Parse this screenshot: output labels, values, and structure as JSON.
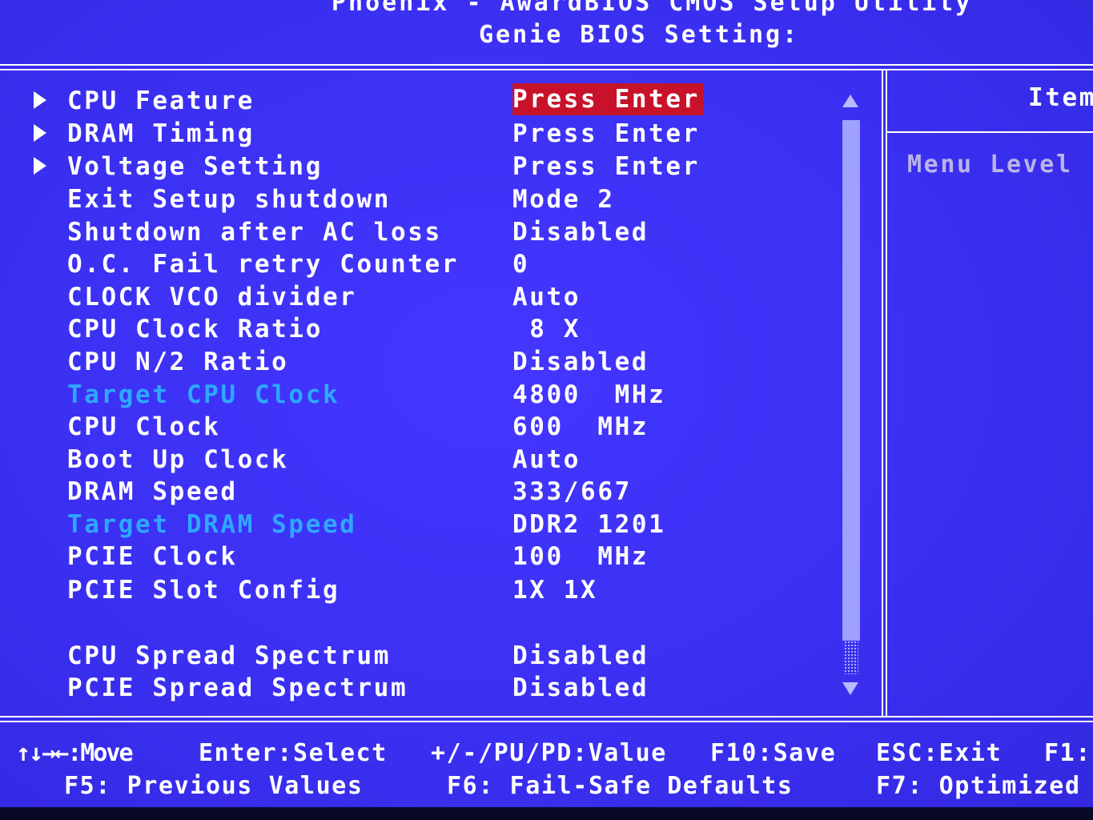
{
  "header": {
    "title": "Phoenix - AwardBIOS CMOS Setup Utility",
    "subtitle": "Genie BIOS Setting:"
  },
  "menu": {
    "items": [
      {
        "label": "CPU Feature",
        "value": "Press Enter",
        "submenu": true,
        "selected": true,
        "highlight": false
      },
      {
        "label": "DRAM Timing",
        "value": "Press Enter",
        "submenu": true,
        "selected": false,
        "highlight": false
      },
      {
        "label": "Voltage Setting",
        "value": "Press Enter",
        "submenu": true,
        "selected": false,
        "highlight": false
      },
      {
        "label": "Exit Setup shutdown",
        "value": "Mode 2",
        "submenu": false,
        "selected": false,
        "highlight": false
      },
      {
        "label": "Shutdown after AC loss",
        "value": "Disabled",
        "submenu": false,
        "selected": false,
        "highlight": false
      },
      {
        "label": "O.C. Fail retry Counter",
        "value": "0",
        "submenu": false,
        "selected": false,
        "highlight": false
      },
      {
        "label": "CLOCK VCO divider",
        "value": "Auto",
        "submenu": false,
        "selected": false,
        "highlight": false
      },
      {
        "label": "CPU Clock Ratio",
        "value": " 8 X",
        "submenu": false,
        "selected": false,
        "highlight": false
      },
      {
        "label": "CPU N/2 Ratio",
        "value": "Disabled",
        "submenu": false,
        "selected": false,
        "highlight": false
      },
      {
        "label": "Target CPU Clock",
        "value": "4800  MHz",
        "submenu": false,
        "selected": false,
        "highlight": true
      },
      {
        "label": "CPU Clock",
        "value": "600  MHz",
        "submenu": false,
        "selected": false,
        "highlight": false
      },
      {
        "label": "Boot Up Clock",
        "value": "Auto",
        "submenu": false,
        "selected": false,
        "highlight": false
      },
      {
        "label": "DRAM Speed",
        "value": "333/667",
        "submenu": false,
        "selected": false,
        "highlight": false
      },
      {
        "label": "Target DRAM Speed",
        "value": "DDR2 1201",
        "submenu": false,
        "selected": false,
        "highlight": true
      },
      {
        "label": "PCIE Clock",
        "value": "100  MHz",
        "submenu": false,
        "selected": false,
        "highlight": false
      },
      {
        "label": "PCIE Slot Config",
        "value": "1X 1X",
        "submenu": false,
        "selected": false,
        "highlight": false
      },
      {
        "label": "CPU Spread Spectrum",
        "value": "Disabled",
        "submenu": false,
        "selected": false,
        "highlight": false
      },
      {
        "label": "PCIE Spread Spectrum",
        "value": "Disabled",
        "submenu": false,
        "selected": false,
        "highlight": false
      }
    ]
  },
  "help_panel": {
    "item_help": "Item",
    "menu_level": "Menu Level"
  },
  "footer": {
    "move": "↑↓→←:Move",
    "select": "Enter:Select",
    "value": "+/-/PU/PD:Value",
    "save": "F10:Save",
    "exit": "ESC:Exit",
    "help": "F1:",
    "previous": "F5: Previous Values",
    "failsafe": "F6: Fail-Safe Defaults",
    "optimized": "F7: Optimized"
  },
  "colors": {
    "background": "#3b32f0",
    "text": "#ffffff",
    "highlight_text": "#2ea8ff",
    "selection": "#c8122a",
    "dim_text": "#b9b4e8"
  }
}
